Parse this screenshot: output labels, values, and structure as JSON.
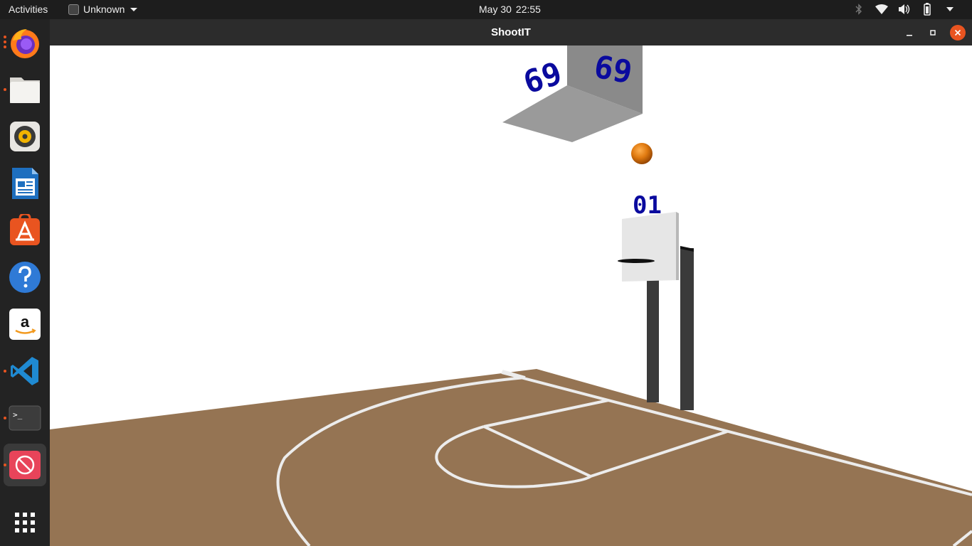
{
  "topbar": {
    "activities_label": "Activities",
    "app_menu_label": "Unknown",
    "clock_date": "May 30",
    "clock_time": "22:55",
    "tray_icons": [
      "bluetooth-icon",
      "wifi-icon",
      "volume-icon",
      "battery-icon",
      "system-menu-icon"
    ]
  },
  "dock": {
    "items": [
      {
        "name": "firefox",
        "running": true
      },
      {
        "name": "files",
        "running": true
      },
      {
        "name": "rhythmbox",
        "running": false
      },
      {
        "name": "libreoffice-writer",
        "running": false
      },
      {
        "name": "ubuntu-software",
        "running": false
      },
      {
        "name": "help",
        "running": false
      },
      {
        "name": "amazon",
        "running": false
      },
      {
        "name": "vscode",
        "running": true
      },
      {
        "name": "terminal",
        "running": true
      },
      {
        "name": "unknown-app",
        "running": true,
        "active": true
      }
    ],
    "show_apps_icon": "grid-icon"
  },
  "window": {
    "title": "ShootIT",
    "controls": [
      "minimize-icon",
      "maximize-icon",
      "close-icon"
    ],
    "close_color": "#e95420"
  },
  "game": {
    "scoreboard_left": "69",
    "scoreboard_right": "69",
    "hoop_score": "01",
    "court_color": "#957453",
    "line_color": "#ececec",
    "ball_color": "#e07a10",
    "digit_color": "#0a0a9e"
  }
}
